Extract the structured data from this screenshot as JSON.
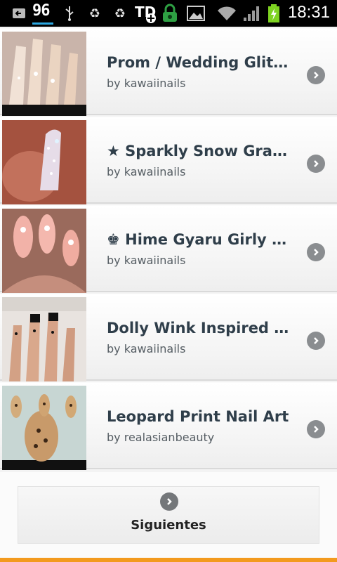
{
  "status_bar": {
    "notification_count": "96",
    "time": "18:31",
    "icons": [
      "back-arrow-icon",
      "usb-icon",
      "recycle-icon",
      "recycle-icon",
      "td-plus-icon",
      "lock-icon",
      "image-icon",
      "wifi-icon",
      "signal-icon",
      "battery-charging-icon"
    ]
  },
  "videos": [
    {
      "title": "Prom / Wedding Glitzy Nail Art",
      "author": "by kawaiinails"
    },
    {
      "title": "★ Sparkly Snow Gradient Nails",
      "author": "by kawaiinails"
    },
    {
      "title": "♚ Hime Gyaru Girly Nail Art",
      "author": "by kawaiinails"
    },
    {
      "title": "Dolly Wink Inspired Nail Art",
      "author": "by kawaiinails"
    },
    {
      "title": "Leopard Print Nail Art",
      "author": "by realasianbeauty"
    }
  ],
  "more_button": {
    "label": "Siguientes"
  },
  "colors": {
    "accent_bar": "#f39a1e",
    "chevron": "#8a8d90",
    "title": "#2f3e4a"
  }
}
